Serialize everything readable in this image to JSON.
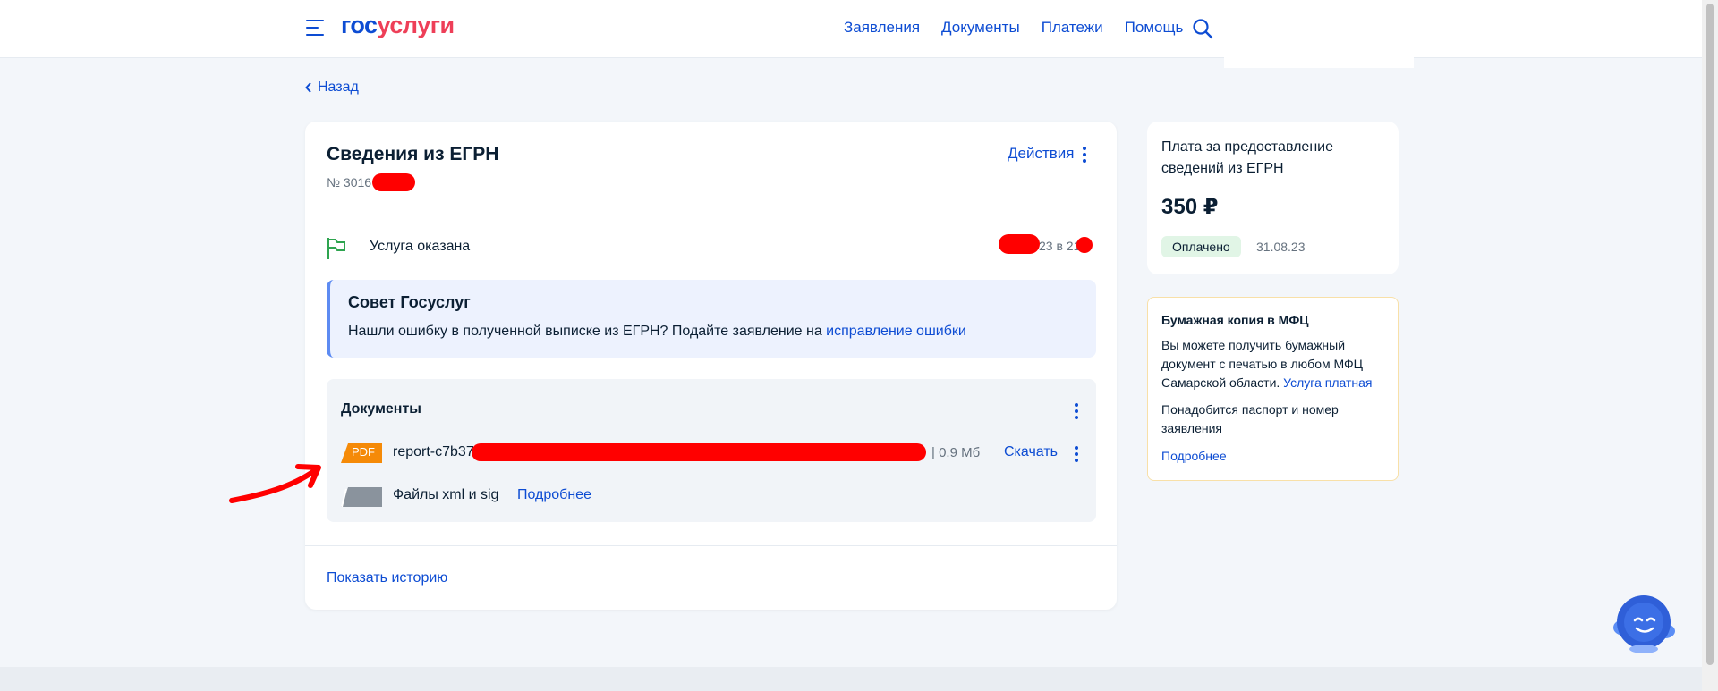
{
  "header": {
    "logo_part1": "гос",
    "logo_part2": "услуги",
    "nav": [
      "Заявления",
      "Документы",
      "Платежи",
      "Помощь"
    ]
  },
  "back_label": "Назад",
  "card": {
    "title": "Сведения из ЕГРН",
    "number": "№ 3016",
    "actions_label": "Действия",
    "status": "Услуга оказана",
    "status_date": "23 в 21",
    "tip": {
      "title": "Совет Госуслуг",
      "text": "Нашли ошибку в полученной выписке из ЕГРН? Подайте заявление на ",
      "link": "исправление ошибки"
    },
    "documents": {
      "title": "Документы",
      "file_type": "PDF",
      "file_name": "report-c7b37",
      "file_size": "|  0.9 Мб",
      "download": "Скачать",
      "xml_label": "Файлы xml и sig",
      "xml_more": "Подробнее"
    },
    "history_link": "Показать историю"
  },
  "payment": {
    "title": "Плата за предоставление сведений из ЕГРН",
    "price": "350 ₽",
    "badge": "Оплачено",
    "date": "31.08.23"
  },
  "paper_copy": {
    "title": "Бумажная копия в МФЦ",
    "text": "Вы можете получить бумажный документ с печатью в любом МФЦ Самарской области. ",
    "paid_link": "Услуга платная",
    "need": "Понадобится паспорт и номер заявления",
    "more": "Подробнее"
  },
  "colors": {
    "accent": "#0d4cd3",
    "logo_red": "#ee3f58",
    "status_green": "#2ea44f",
    "pdf_orange": "#f58a08",
    "redaction": "#ff0000"
  }
}
